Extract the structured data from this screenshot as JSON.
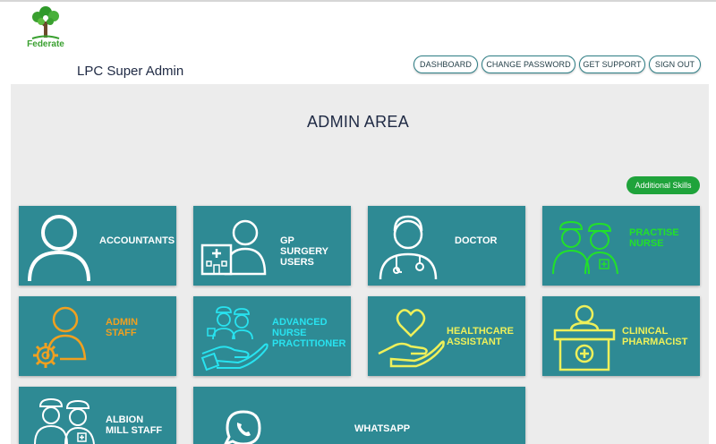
{
  "logo": {
    "text": "Federate"
  },
  "header": {
    "title": "LPC Super Admin"
  },
  "nav": {
    "dashboard": "DASHBOARD",
    "change_password": "CHANGE PASSWORD",
    "get_support": "GET SUPPORT",
    "sign_out": "SIGN OUT"
  },
  "main": {
    "title": "ADMIN AREA",
    "additional_skills": "Additional Skills"
  },
  "tiles": {
    "accountants": {
      "line1": "ACCOUNTANTS"
    },
    "gp_surgery_users": {
      "line1": "GP",
      "line2": "SURGERY",
      "line3": "USERS"
    },
    "doctor": {
      "line1": "DOCTOR"
    },
    "practise_nurse": {
      "line1": "PRACTISE",
      "line2": "NURSE"
    },
    "admin_staff": {
      "line1": "ADMIN",
      "line2": "STAFF"
    },
    "advanced_nurse_practitioner": {
      "line1": "ADVANCED",
      "line2": "NURSE",
      "line3": "PRACTITIONER"
    },
    "healthcare_assistant": {
      "line1": "HEALTHCARE",
      "line2": "ASSISTANT"
    },
    "clinical_pharmacist": {
      "line1": "CLINICAL",
      "line2": "PHARMACIST"
    },
    "albion_mill_staff": {
      "line1": "ALBION",
      "line2": "MILL STAFF"
    },
    "whatsapp": {
      "line1": "WHATSAPP"
    }
  },
  "colors": {
    "tile": "#2e8a94",
    "white": "#ffffff",
    "nurse_green": "#22e02a",
    "admin_orange": "#f0a020",
    "cyan": "#28e3f0",
    "yellow": "#eef05a",
    "brand_green": "#1fa33b"
  }
}
